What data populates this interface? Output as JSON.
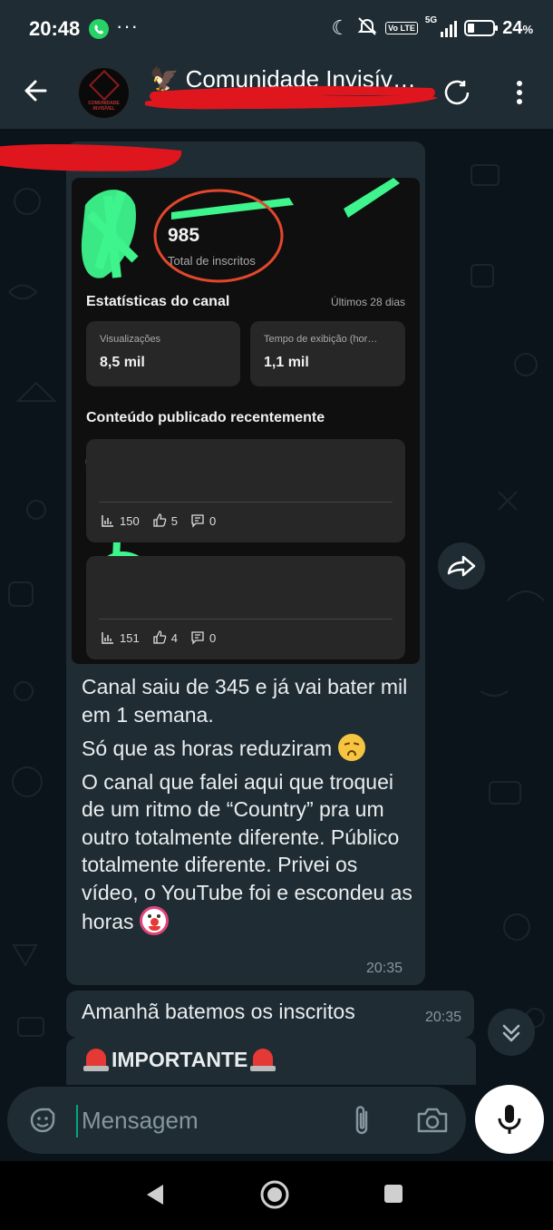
{
  "status_bar": {
    "time": "20:48",
    "dots": "···",
    "volte": "Vo LTE",
    "network": "5G",
    "battery_value": "24",
    "battery_unit": "%",
    "icons": [
      "whatsapp-icon",
      "moon-icon",
      "mute-icon",
      "signal-icon",
      "battery-icon"
    ]
  },
  "header": {
    "title": "🦅 Comunidade Invisív…",
    "avatar_text": "COMUNIDADE INVISÍVEL"
  },
  "message": {
    "screenshot": {
      "subscriber_count": "985",
      "subscriber_label": "Total de inscritos",
      "stats_title": "Estatísticas do canal",
      "stats_period": "Últimos 28 dias",
      "stat_cards": [
        {
          "label": "Visualizações",
          "value": "8,5 mil"
        },
        {
          "label": "Tempo de exibição (hor…",
          "value": "1,1 mil"
        }
      ],
      "recent_title": "Conteúdo publicado recentemente",
      "videos": [
        {
          "views": "150",
          "likes": "5",
          "comments": "0"
        },
        {
          "views": "151",
          "likes": "4",
          "comments": "0"
        }
      ]
    },
    "paragraphs": [
      "Canal saiu de 345 e já vai bater mil em 1 semana.",
      "Só que as horas reduziram",
      "O canal que falei aqui que troquei de um ritmo de “Country” pra um outro totalmente diferente. Público totalmente diferente. Privei os vídeo, o YouTube foi e escondeu as horas"
    ],
    "time": "20:35"
  },
  "message2": {
    "text": "Amanhã batemos os inscritos",
    "time": "20:35"
  },
  "message3": {
    "text": "IMPORTANTE"
  },
  "input": {
    "placeholder": "Mensagem"
  },
  "colors": {
    "background": "#0b141a",
    "bubble": "#1f2c33",
    "header": "#1f2c33",
    "timestamp": "#8696a0",
    "redaction_red": "#e0161f",
    "redaction_green": "#3df58c"
  }
}
